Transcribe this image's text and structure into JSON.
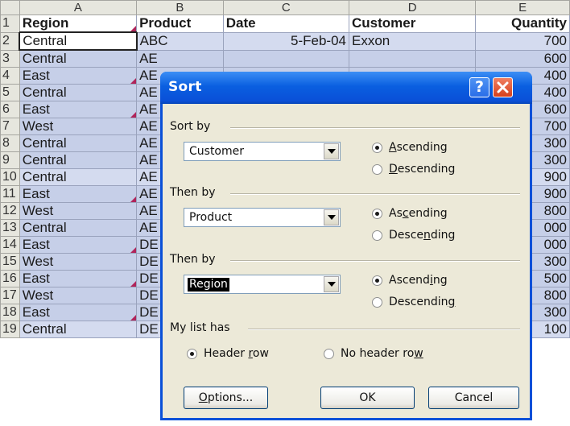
{
  "sheet": {
    "columns": [
      "A",
      "B",
      "C",
      "D",
      "E"
    ],
    "header": {
      "row": "1",
      "region": "Region",
      "product": "Product",
      "date": "Date",
      "customer": "Customer",
      "quantity": "Quantity"
    },
    "rows": [
      {
        "row": "2",
        "region": "Central",
        "product": "ABC",
        "date": "5-Feb-04",
        "customer": "Exxon",
        "quantity": "700"
      },
      {
        "row": "3",
        "region": "Central",
        "product": "AE",
        "date": "",
        "customer": "",
        "quantity": "600"
      },
      {
        "row": "4",
        "region": "East",
        "product": "AE",
        "date": "",
        "customer": "",
        "quantity": "400"
      },
      {
        "row": "5",
        "region": "Central",
        "product": "AE",
        "date": "",
        "customer": "",
        "quantity": "400"
      },
      {
        "row": "6",
        "region": "East",
        "product": "AE",
        "date": "",
        "customer": "",
        "quantity": "600"
      },
      {
        "row": "7",
        "region": "West",
        "product": "AE",
        "date": "",
        "customer": "",
        "quantity": "700"
      },
      {
        "row": "8",
        "region": "Central",
        "product": "AE",
        "date": "",
        "customer": "",
        "quantity": "300"
      },
      {
        "row": "9",
        "region": "Central",
        "product": "AE",
        "date": "",
        "customer": "",
        "quantity": "300"
      },
      {
        "row": "10",
        "region": "Central",
        "product": "AE",
        "date": "",
        "customer": "",
        "quantity": "900"
      },
      {
        "row": "11",
        "region": "East",
        "product": "AE",
        "date": "",
        "customer": "",
        "quantity": "900"
      },
      {
        "row": "12",
        "region": "West",
        "product": "AE",
        "date": "",
        "customer": "",
        "quantity": "800"
      },
      {
        "row": "13",
        "region": "Central",
        "product": "AE",
        "date": "",
        "customer": "",
        "quantity": "000"
      },
      {
        "row": "14",
        "region": "East",
        "product": "DE",
        "date": "",
        "customer": "",
        "quantity": "000"
      },
      {
        "row": "15",
        "region": "West",
        "product": "DE",
        "date": "",
        "customer": "",
        "quantity": "300"
      },
      {
        "row": "16",
        "region": "East",
        "product": "DE",
        "date": "",
        "customer": "",
        "quantity": "500"
      },
      {
        "row": "17",
        "region": "West",
        "product": "DE",
        "date": "",
        "customer": "",
        "quantity": "800"
      },
      {
        "row": "18",
        "region": "East",
        "product": "DE",
        "date": "",
        "customer": "",
        "quantity": "300"
      },
      {
        "row": "19",
        "region": "Central",
        "product": "DE",
        "date": "",
        "customer": "",
        "quantity": "100"
      }
    ]
  },
  "dialog": {
    "title": "Sort",
    "help_icon": "question-mark",
    "close_icon": "x-mark",
    "sort_by": {
      "label": "Sort by",
      "value": "Customer",
      "ascending": {
        "pre": "",
        "key": "A",
        "post": "scending"
      },
      "descending": {
        "pre": "",
        "key": "D",
        "post": "escending"
      },
      "selected": "ascending"
    },
    "then_by_1": {
      "label": "Then by",
      "value": "Product",
      "ascending": {
        "pre": "As",
        "key": "c",
        "post": "ending"
      },
      "descending": {
        "pre": "Desce",
        "key": "n",
        "post": "ding"
      },
      "selected": "ascending"
    },
    "then_by_2": {
      "label": "Then by",
      "value": "Region",
      "ascending": {
        "pre": "Ascend",
        "key": "i",
        "post": "ng"
      },
      "descending": {
        "pre": "Descendin",
        "key": "g",
        "post": ""
      },
      "selected": "ascending"
    },
    "my_list_has": {
      "label": "My list has",
      "header_row": {
        "pre": "Header ",
        "key": "r",
        "post": "ow"
      },
      "no_header_row": {
        "pre": "No header ro",
        "key": "w",
        "post": ""
      },
      "selected": "header_row"
    },
    "buttons": {
      "options": {
        "pre": "",
        "key": "O",
        "post": "ptions..."
      },
      "ok": "OK",
      "cancel": "Cancel"
    }
  },
  "colors": {
    "title_bar": "#0a50d8",
    "dialog_bg": "#ece9d8",
    "cell_highlight": "#c6cfe8",
    "close_button": "#d6401c",
    "comment_marker": "#b0245a"
  }
}
